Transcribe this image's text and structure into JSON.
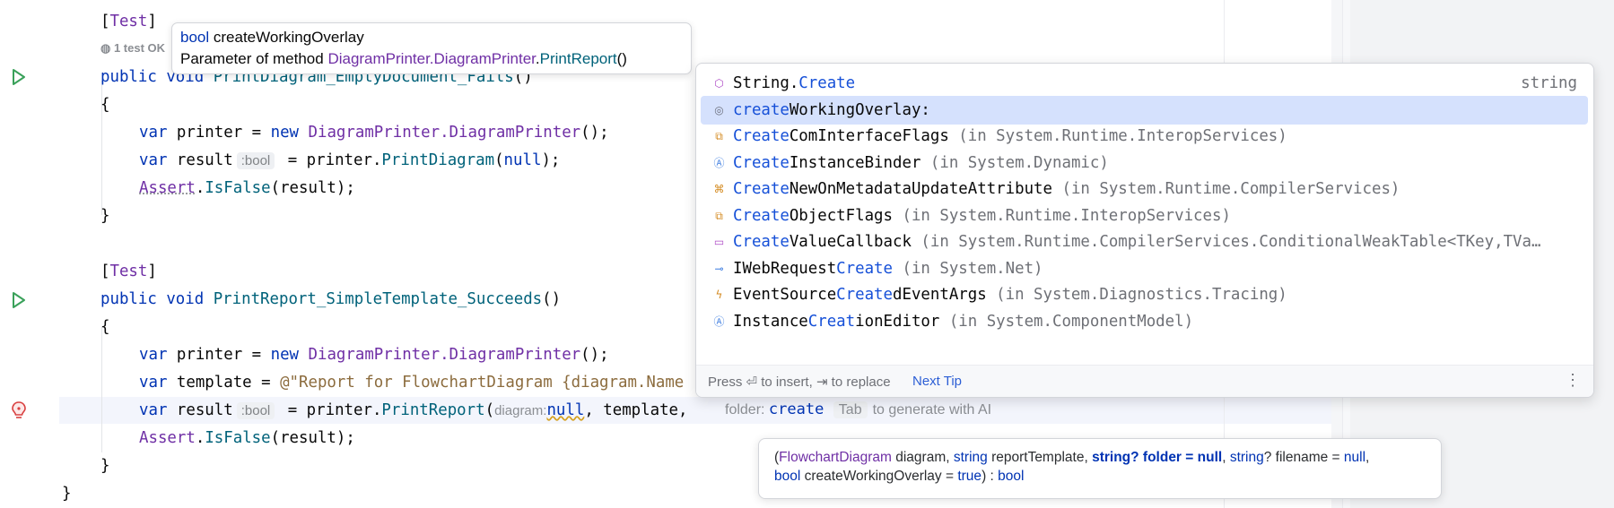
{
  "code": {
    "l1_attr": "Test",
    "test_status": "1 test OK",
    "l2_public": "public",
    "l2_void": "void",
    "l2_name": "PrintDiagram_EmptyDocument_Fails",
    "l2_parens": "()",
    "brace_open": "{",
    "brace_close": "}",
    "var": "var",
    "new": "new",
    "printer_decl": " printer = ",
    "ctor": "DiagramPrinter.DiagramPrinter",
    "ctor_tail": "();",
    "result": " result",
    "bool_hint": ":bool",
    "assign_printer": " = printer.",
    "print_diagram": "PrintDiagram",
    "null": "null",
    "call_tail": ");",
    "assert": "Assert",
    "is_false": "IsFalse",
    "assert_args": "(result);",
    "l10_name": "PrintReport_SimpleTemplate_Succeeds",
    "template_decl": " template = ",
    "template_str": "@\"Report for FlowchartDiagram {diagram.Name",
    "print_report": "PrintReport",
    "diagram_hint": "diagram:",
    "template_arg": ", template, ",
    "dot": "."
  },
  "tooltip": {
    "type": "bool",
    "param": "createWorkingOverlay",
    "desc": "Parameter of method",
    "class_ref": "DiagramPrinter.DiagramPrinter",
    "method_ref": "PrintReport",
    "parens": "()"
  },
  "completion": {
    "items": [
      {
        "pre": "String.",
        "match": "Create",
        "post": "",
        "loc": "",
        "rt": "string",
        "icon": "cube-icon",
        "color": "#b04ec7"
      },
      {
        "pre": "",
        "match": "create",
        "post": "WorkingOverlay:",
        "loc": "",
        "rt": "",
        "icon": "parameter-icon",
        "color": "#6c707e"
      },
      {
        "pre": "",
        "match": "Create",
        "post": "ComInterfaceFlags",
        "loc": " (in System.Runtime.InteropServices)",
        "rt": "",
        "icon": "enum-icon",
        "color": "#d48a20"
      },
      {
        "pre": "",
        "match": "Create",
        "post": "InstanceBinder",
        "loc": " (in System.Dynamic)",
        "rt": "",
        "icon": "class-abstract-icon",
        "color": "#3f7ee0"
      },
      {
        "pre": "",
        "match": "Create",
        "post": "NewOnMetadataUpdateAttribute",
        "loc": " (in System.Runtime.CompilerServices)",
        "rt": "",
        "icon": "attribute-icon",
        "color": "#d48a20"
      },
      {
        "pre": "",
        "match": "Create",
        "post": "ObjectFlags",
        "loc": " (in System.Runtime.InteropServices)",
        "rt": "",
        "icon": "enum-icon",
        "color": "#d48a20"
      },
      {
        "pre": "",
        "match": "Create",
        "post": "ValueCallback",
        "loc": " (in System.Runtime.CompilerServices.ConditionalWeakTable<TKey,TVa…",
        "rt": "",
        "icon": "delegate-icon",
        "color": "#b04ec7"
      },
      {
        "pre": "IWebRequest",
        "match": "Create",
        "post": "",
        "loc": " (in System.Net)",
        "rt": "",
        "icon": "interface-icon",
        "color": "#3f7ee0"
      },
      {
        "pre": "EventSource",
        "match": "Create",
        "post": "dEventArgs",
        "loc": " (in System.Diagnostics.Tracing)",
        "rt": "",
        "icon": "class-event-icon",
        "color": "#d48a20"
      },
      {
        "pre": "Instance",
        "match": "Creat",
        "post": "ionEditor",
        "loc": " (in System.ComponentModel)",
        "rt": "",
        "icon": "class-abstract-icon",
        "color": "#3f7ee0"
      }
    ],
    "footer_hint": "Press ⏎ to insert, ⇥ to replace",
    "next_tip": "Next Tip",
    "more": "⋮"
  },
  "ai_suggestion": {
    "param_hint": "folder:",
    "value": "create",
    "key": "Tab",
    "text": "to generate with AI"
  },
  "param_info": {
    "open": "(",
    "p1_type": "FlowchartDiagram",
    "p1_name": " diagram, ",
    "p2_type": "string",
    "p2_name": " reportTemplate, ",
    "p3": "string? folder = null",
    "comma": ", ",
    "p4_type": "string",
    "p4_name": "? filename = ",
    "p4_val": "null",
    "p5_type": "bool",
    "p5_name": " createWorkingOverlay = ",
    "p5_val": "true",
    "close": ") : ",
    "ret": "bool"
  }
}
